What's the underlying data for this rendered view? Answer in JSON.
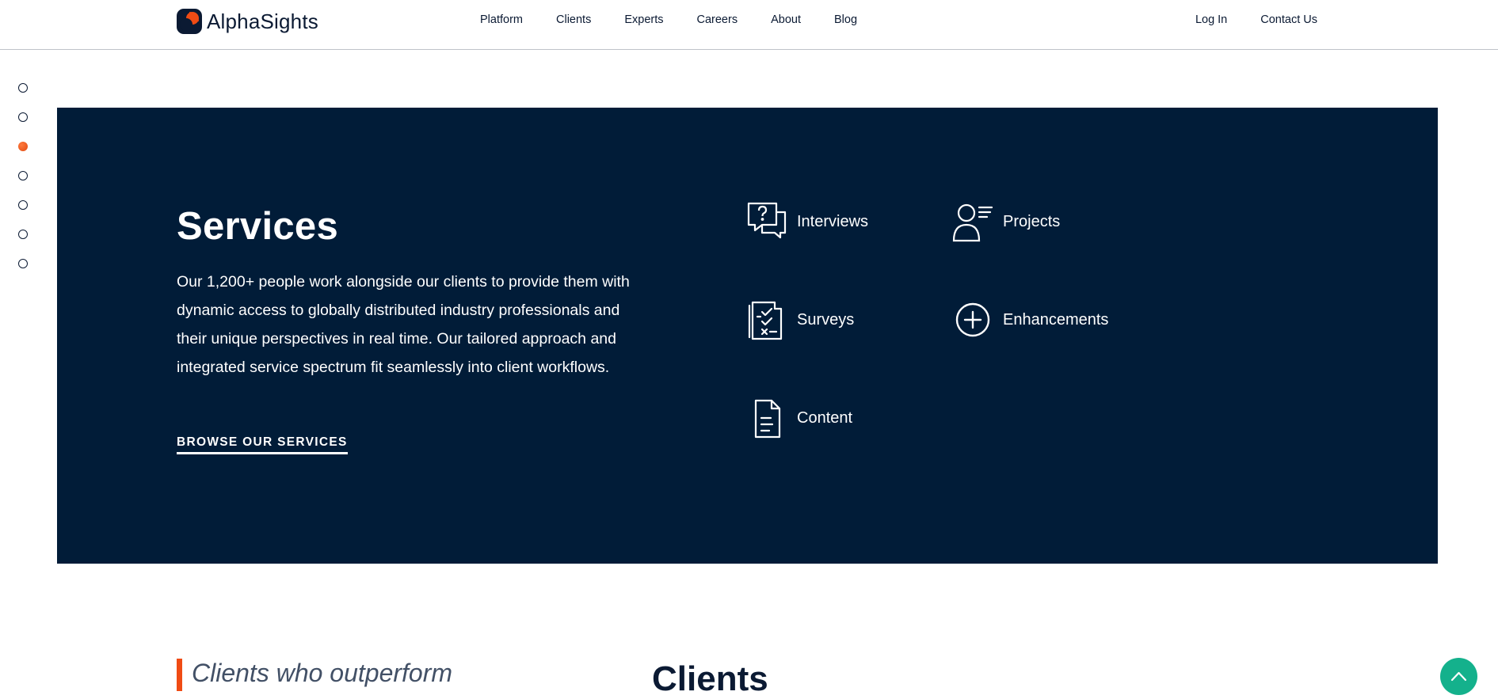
{
  "brand": {
    "name": "AlphaSights",
    "accent": "#f04b14",
    "navy": "#011c38"
  },
  "nav": {
    "items": [
      "Platform",
      "Clients",
      "Experts",
      "Careers",
      "About",
      "Blog"
    ],
    "right": [
      "Log In",
      "Contact Us"
    ]
  },
  "side_nav": {
    "count": 7,
    "active_index": 2
  },
  "services": {
    "title": "Services",
    "description": "Our 1,200+ people work alongside our clients to provide them with dynamic access to globally distributed industry professionals and their unique perspectives in real time. Our tailored approach and integrated service spectrum fit seamlessly into client workflows.",
    "cta": "BROWSE OUR SERVICES",
    "items": [
      {
        "label": "Interviews",
        "icon": "chat-question-icon"
      },
      {
        "label": "Projects",
        "icon": "person-list-icon"
      },
      {
        "label": "Surveys",
        "icon": "clipboard-check-icon"
      },
      {
        "label": "Enhancements",
        "icon": "plus-circle-icon"
      },
      {
        "label": "Content",
        "icon": "document-icon"
      }
    ]
  },
  "clients": {
    "tagline": "Clients who outperform",
    "title": "Clients"
  },
  "scroll_top": {
    "icon": "chevron-up-icon",
    "color": "#14b18c"
  }
}
